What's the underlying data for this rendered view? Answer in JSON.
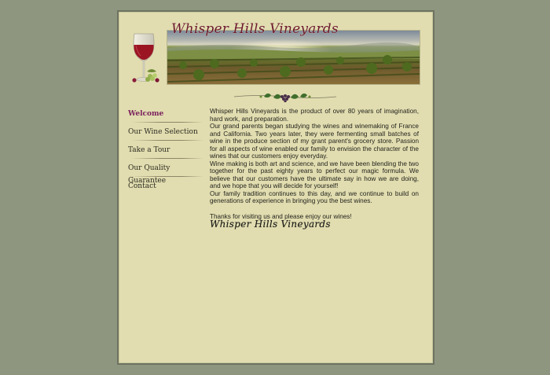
{
  "header": {
    "title": "Whisper Hills Vineyards"
  },
  "nav": {
    "items": [
      {
        "label": "Welcome"
      },
      {
        "label": "Our Wine Selection"
      },
      {
        "label": "Take a Tour"
      },
      {
        "label": "Our Quality Guarantee"
      },
      {
        "label": "Contact"
      }
    ],
    "active_index": 0
  },
  "content": {
    "paragraphs": [
      "Whisper Hills Vineyards is the product of over 80 years of imagination, hard work, and preparation.",
      "Our grand parents began studying the wines and winemaking of France and California. Two years later, they were fermenting small batches of wine in the produce section of my grant parent's grocery store.  Passion for all aspects of wine enabled our family to envision the character of the wines that our customers enjoy everyday.",
      "Wine making is both art and science, and we have been blending the two together for the past eighty years to perfect our magic formula. We believe that our customers have the ultimate say in how we are doing, and we hope that you will decide for yourself!",
      "Our family tradition continues to this day, and we continue to build on generations of experience in bringing you the best wines."
    ],
    "thanks": "Thanks for visiting us and please enjoy our wines!",
    "signature": "Whisper Hills Vineyards"
  },
  "colors": {
    "background": "#8f9680",
    "page": "#e1ddb0",
    "active_nav": "#7a1f5c",
    "title": "#6b1a2c"
  },
  "icons": [
    "wine-glass-icon",
    "grape-vine-ornament-icon"
  ]
}
